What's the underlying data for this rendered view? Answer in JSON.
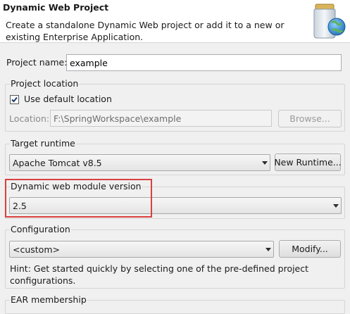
{
  "header": {
    "title": "Dynamic Web Project",
    "description": "Create a standalone Dynamic Web project or add it to a new or existing Enterprise Application."
  },
  "project_name": {
    "label": "Project name:",
    "value": "example"
  },
  "project_location": {
    "group_title": "Project location",
    "use_default_label": "Use default location",
    "use_default_checked": true,
    "location_label": "Location:",
    "location_value": "F:\\SpringWorkspace\\example",
    "browse_label": "Browse..."
  },
  "target_runtime": {
    "group_title": "Target runtime",
    "selected": "Apache Tomcat v8.5",
    "new_runtime_label": "New Runtime..."
  },
  "web_module": {
    "group_title": "Dynamic web module version",
    "selected": "2.5"
  },
  "configuration": {
    "group_title": "Configuration",
    "selected": "<custom>",
    "modify_label": "Modify...",
    "hint": "Hint: Get started quickly by selecting one of the pre-defined project configurations."
  },
  "ear_membership": {
    "group_title": "EAR membership"
  },
  "colors": {
    "highlight": "#d94040",
    "banner_bg": "#ffffff",
    "dialog_bg": "#f0f0f0"
  }
}
